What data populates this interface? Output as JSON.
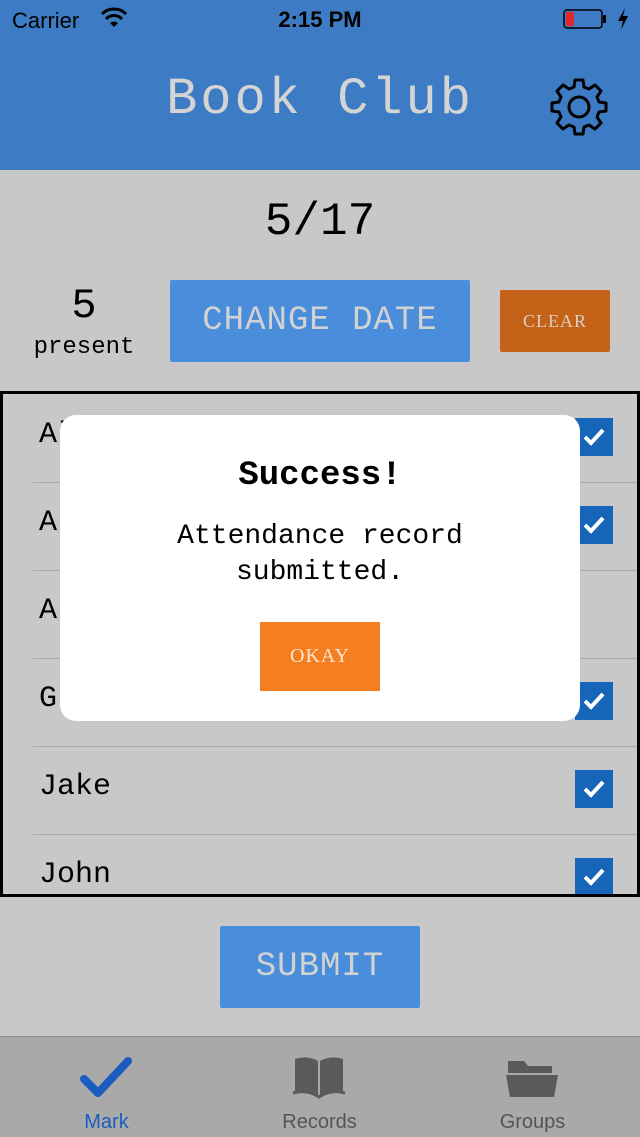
{
  "status_bar": {
    "carrier": "Carrier",
    "time": "2:15 PM",
    "battery_color": "#e0262b"
  },
  "header": {
    "title": "Book Club",
    "settings_icon": "gear-icon",
    "background": "#3d7cc4"
  },
  "attendance": {
    "date": "5/17",
    "present_count": "5",
    "present_label": "present",
    "change_date_label": "CHANGE DATE",
    "clear_label": "CLEAR"
  },
  "members": [
    {
      "name": "Al",
      "checked": true
    },
    {
      "name": "A",
      "checked": true
    },
    {
      "name": "A",
      "checked": false
    },
    {
      "name": "G",
      "checked": true
    },
    {
      "name": "Jake",
      "checked": true
    },
    {
      "name": "John",
      "checked": true
    }
  ],
  "dialog": {
    "title": "Success!",
    "message": "Attendance record submitted.",
    "okay_label": "OKAY"
  },
  "submit_label": "SUBMIT",
  "tabs": [
    {
      "label": "Mark",
      "icon": "checkmark-icon",
      "active": true
    },
    {
      "label": "Records",
      "icon": "book-icon",
      "active": false
    },
    {
      "label": "Groups",
      "icon": "folder-icon",
      "active": false
    }
  ]
}
